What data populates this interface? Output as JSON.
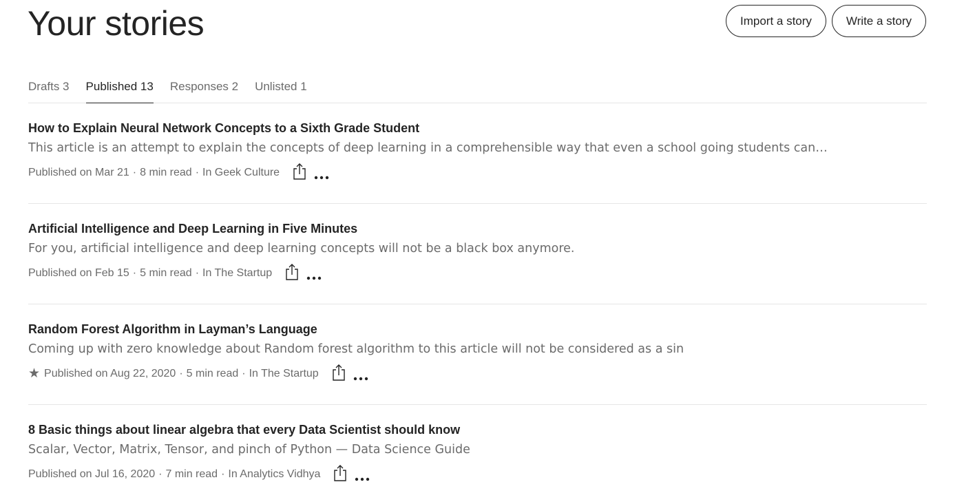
{
  "header": {
    "title": "Your stories",
    "import_label": "Import a story",
    "write_label": "Write a story"
  },
  "tabs": [
    {
      "label": "Drafts 3",
      "active": false
    },
    {
      "label": "Published 13",
      "active": true
    },
    {
      "label": "Responses 2",
      "active": false
    },
    {
      "label": "Unlisted 1",
      "active": false
    }
  ],
  "stories": [
    {
      "title": "How to Explain Neural Network Concepts to a Sixth Grade Student",
      "subtitle": "This article is an attempt to explain the concepts of deep learning in a comprehensible way that even a school going students can…",
      "published": "Published on Mar 21",
      "read_time": "8 min read",
      "publication": "In Geek Culture",
      "starred": false
    },
    {
      "title": "Artificial Intelligence and Deep Learning in Five Minutes",
      "subtitle": "For you, artificial intelligence and deep learning concepts will not be a black box anymore.",
      "published": "Published on Feb 15",
      "read_time": "5 min read",
      "publication": "In The Startup",
      "starred": false
    },
    {
      "title": "Random Forest Algorithm in Layman’s Language",
      "subtitle": "Coming up with zero knowledge about Random forest algorithm to this article will not be considered as a sin",
      "published": "Published on Aug 22, 2020",
      "read_time": "5 min read",
      "publication": "In The Startup",
      "starred": true
    },
    {
      "title": "8 Basic things about linear algebra that every Data Scientist should know",
      "subtitle": "Scalar, Vector, Matrix, Tensor, and pinch of Python — Data Science Guide",
      "published": "Published on Jul 16, 2020",
      "read_time": "7 min read",
      "publication": "In Analytics Vidhya",
      "starred": false
    }
  ],
  "icons": {
    "star": "star-icon",
    "share": "share-icon",
    "more": "more-icon"
  },
  "colors": {
    "text_primary": "#242424",
    "text_secondary": "#6b6b6b",
    "divider": "#e6e6e6"
  }
}
